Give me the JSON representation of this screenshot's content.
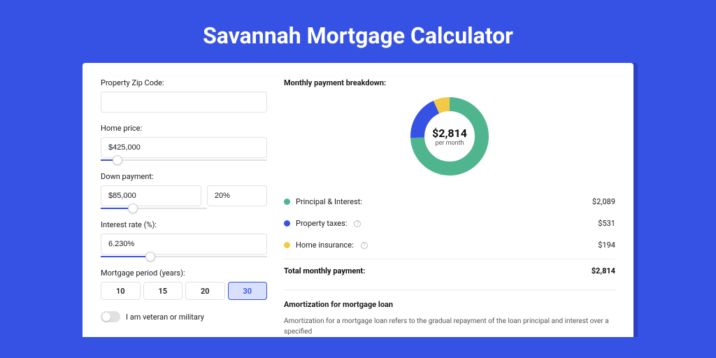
{
  "title": "Savannah Mortgage Calculator",
  "form": {
    "zip_label": "Property Zip Code:",
    "zip_value": "",
    "home_price_label": "Home price:",
    "home_price_value": "$425,000",
    "down_payment_label": "Down payment:",
    "down_payment_value": "$85,000",
    "down_payment_pct": "20%",
    "interest_label": "Interest rate (%):",
    "interest_value": "6.230%",
    "period_label": "Mortgage period (years):",
    "period_options": [
      "10",
      "15",
      "20",
      "30"
    ],
    "period_selected": "30",
    "veteran_label": "I am veteran or military"
  },
  "breakdown": {
    "heading": "Monthly payment breakdown:",
    "total_amount": "$2,814",
    "total_sub": "per month",
    "items": [
      {
        "label": "Principal & Interest:",
        "value": "$2,089",
        "has_info": false
      },
      {
        "label": "Property taxes:",
        "value": "$531",
        "has_info": true
      },
      {
        "label": "Home insurance:",
        "value": "$194",
        "has_info": true
      }
    ],
    "total_label": "Total monthly payment:",
    "total_value": "$2,814"
  },
  "amort": {
    "heading": "Amortization for mortgage loan",
    "body": "Amortization for a mortgage loan refers to the gradual repayment of the loan principal and interest over a specified"
  },
  "colors": {
    "pi": "#4fb58f",
    "taxes": "#3652e5",
    "ins": "#f3c948"
  },
  "chart_data": {
    "type": "pie",
    "title": "Monthly payment breakdown",
    "series": [
      {
        "name": "Principal & Interest",
        "value": 2089,
        "color": "#4fb58f"
      },
      {
        "name": "Property taxes",
        "value": 531,
        "color": "#3652e5"
      },
      {
        "name": "Home insurance",
        "value": 194,
        "color": "#f3c948"
      }
    ],
    "total": 2814,
    "center_label": "$2,814",
    "center_sub": "per month"
  }
}
